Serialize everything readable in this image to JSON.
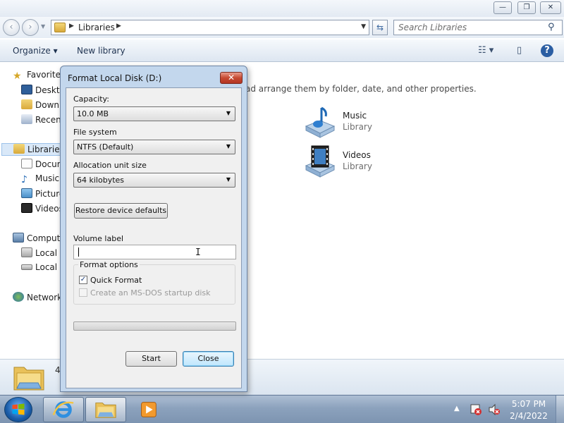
{
  "explorer": {
    "window_controls": {
      "minimize": "—",
      "maximize": "❐",
      "close": "✕"
    },
    "address": {
      "breadcrumb": "Libraries"
    },
    "search": {
      "placeholder": "Search Libraries"
    },
    "toolbar": {
      "organize": "Organize ▾",
      "new_library": "New library"
    },
    "nav_pane": {
      "items": [
        {
          "label": "Favorites",
          "icon": "star-icon"
        },
        {
          "label": "Desktop",
          "icon": "desktop-icon"
        },
        {
          "label": "Downloads",
          "icon": "downloads-icon"
        },
        {
          "label": "Recent Places",
          "icon": "recent-places-icon"
        },
        {
          "label": "Libraries",
          "icon": "libraries-icon"
        },
        {
          "label": "Documents",
          "icon": "documents-icon"
        },
        {
          "label": "Music",
          "icon": "music-icon"
        },
        {
          "label": "Pictures",
          "icon": "pictures-icon"
        },
        {
          "label": "Videos",
          "icon": "videos-icon"
        },
        {
          "label": "Computer",
          "icon": "computer-icon"
        },
        {
          "label": "Local Disk",
          "icon": "local-disk-icon"
        },
        {
          "label": "Local Disk",
          "icon": "local-disk-icon"
        },
        {
          "label": "Network",
          "icon": "network-icon"
        }
      ]
    },
    "content": {
      "info_text": "ad arrange them by folder, date, and other properties.",
      "libraries": [
        {
          "name": "Music",
          "type": "Library"
        },
        {
          "name": "Videos",
          "type": "Library"
        }
      ]
    },
    "details": {
      "count_text": "4"
    }
  },
  "dialog": {
    "title": "Format Local Disk (D:)",
    "close_glyph": "✕",
    "capacity_label": "Capacity:",
    "capacity_value": "10.0 MB",
    "file_system_label": "File system",
    "file_system_value": "NTFS (Default)",
    "allocation_label": "Allocation unit size",
    "allocation_value": "64 kilobytes",
    "restore_button": "Restore device defaults",
    "volume_label_caption": "Volume label",
    "volume_label_value": "",
    "format_options_legend": "Format options",
    "quick_format_label": "Quick Format",
    "quick_format_checked": true,
    "msdos_label": "Create an MS-DOS startup disk",
    "msdos_checked": false,
    "progress_fraction": 0,
    "start_button": "Start",
    "close_button": "Close"
  },
  "taskbar": {
    "pinned": [
      {
        "name": "internet-explorer-icon"
      },
      {
        "name": "windows-explorer-icon"
      },
      {
        "name": "media-player-icon"
      }
    ],
    "clock_time": "5:07 PM",
    "clock_date": "2/4/2022"
  },
  "colors": {
    "accent": "#3c7fb1",
    "close_red": "#c64a32",
    "taskbar": "#8ca2bd"
  }
}
